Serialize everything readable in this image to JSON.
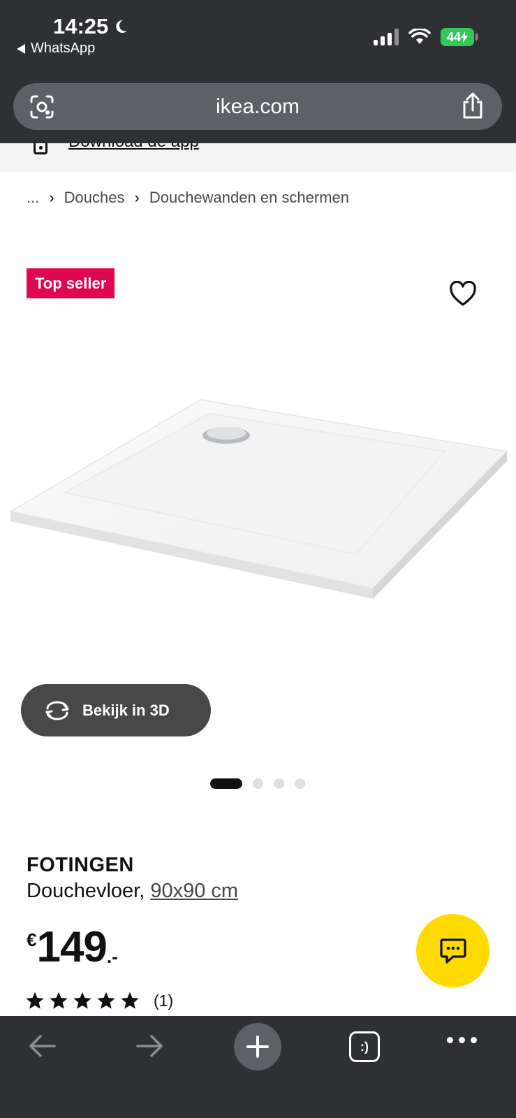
{
  "status_bar": {
    "time": "14:25",
    "back_app": "WhatsApp",
    "battery": "44"
  },
  "browser": {
    "url": "ikea.com"
  },
  "app_banner": {
    "label": "Download de app"
  },
  "breadcrumb": {
    "ellipsis": "...",
    "items": [
      "Douches",
      "Douchewanden en schermen"
    ]
  },
  "product": {
    "badge": "Top seller",
    "view_3d_label": "Bekijk in 3D",
    "gallery": {
      "count": 4,
      "active": 1
    },
    "name": "FOTINGEN",
    "type": "Douchevloer,",
    "size": "90x90 cm",
    "price": {
      "currency": "€",
      "amount": "149",
      "decimals": ".-"
    },
    "rating": {
      "stars": 5,
      "count_text": "(1)"
    }
  },
  "colors": {
    "chrome": "#2e3033",
    "badge": "#e00751",
    "chat": "#ffdb00",
    "battery": "#34c759"
  }
}
